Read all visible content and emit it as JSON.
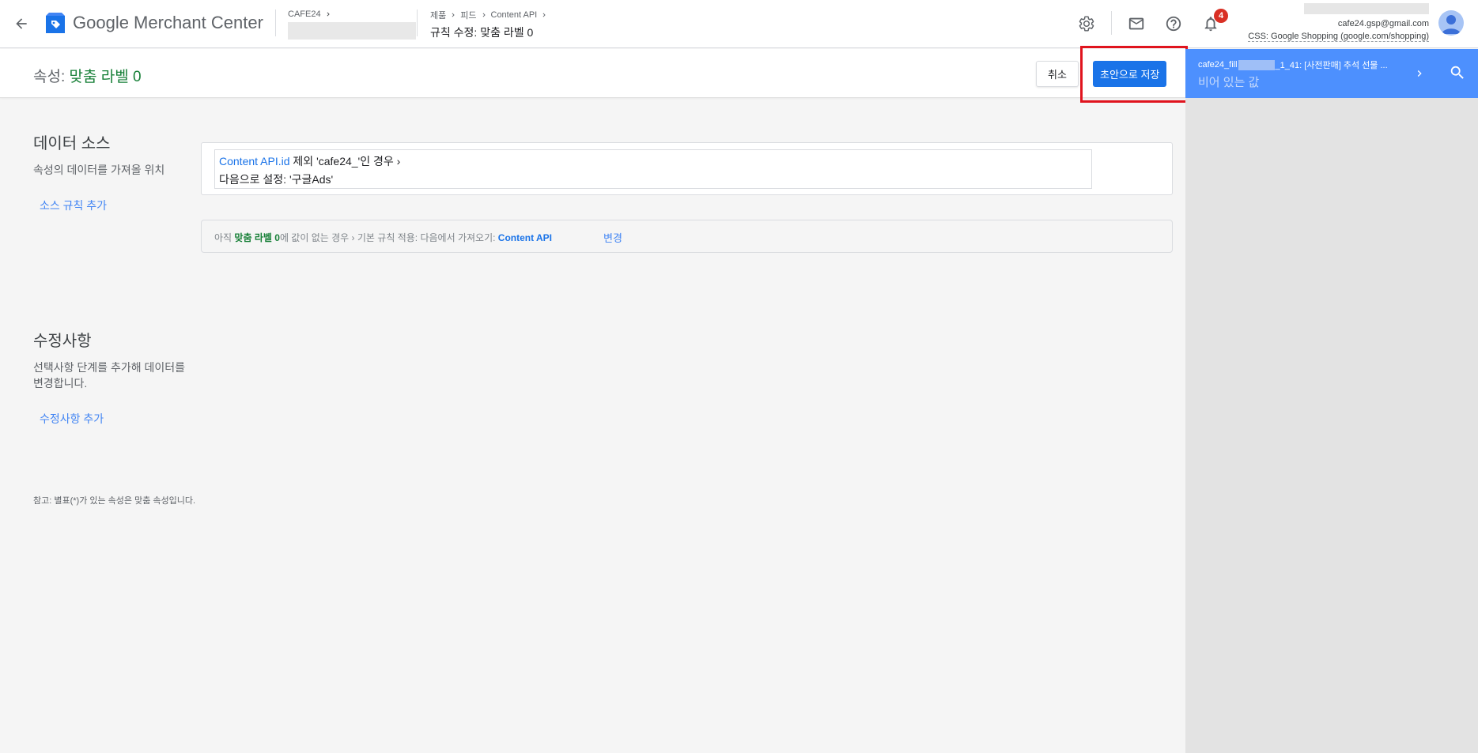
{
  "header": {
    "app_name": "Google Merchant Center",
    "account_name": "CAFE24",
    "breadcrumb": [
      "제품",
      "피드",
      "Content API"
    ],
    "page_title": "규칙 수정: 맞춤 라벨 0",
    "notification_count": "4",
    "user_email": "cafe24.gsp@gmail.com",
    "css_label": "CSS: Google Shopping (google.com/shopping)"
  },
  "subheader": {
    "attribute_prefix": "속성: ",
    "attribute_name": "맞춤 라벨 0",
    "cancel_label": "취소",
    "save_label": "초안으로 저장"
  },
  "side_panel": {
    "item_prefix": "cafe24_fill",
    "item_suffix": "_1_41: [사전판매] 추석 선물 ...",
    "item_value": "비어 있는 값"
  },
  "data_source": {
    "title": "데이터 소스",
    "description": "속성의 데이터를 가져올 위치",
    "add_link": "소스 규칙 추가",
    "rule": {
      "field": "Content API.id",
      "condition": " 제외 ",
      "value": "'cafe24_'",
      "condition_end": "인 경우 ›",
      "set_line": "다음으로 설정: '구글Ads'"
    },
    "default": {
      "prefix": "아직 ",
      "attribute": "맞춤 라벨 0",
      "middle": "에 값이 없는 경우 › 기본 규칙 적용: 다음에서 가져오기: ",
      "source": "Content API",
      "change_link": "변경"
    }
  },
  "modifications": {
    "title": "수정사항",
    "description": "선택사항 단계를 추가해 데이터를 변경합니다.",
    "add_link": "수정사항 추가"
  },
  "note": "참고: 별표(*)가 있는 속성은 맞춤 속성입니다.",
  "colors": {
    "primary": "#1a73e8",
    "accent_green": "#188038",
    "panel_blue": "#4d90fe",
    "highlight_red": "#e0141e",
    "badge_red": "#d93025"
  }
}
